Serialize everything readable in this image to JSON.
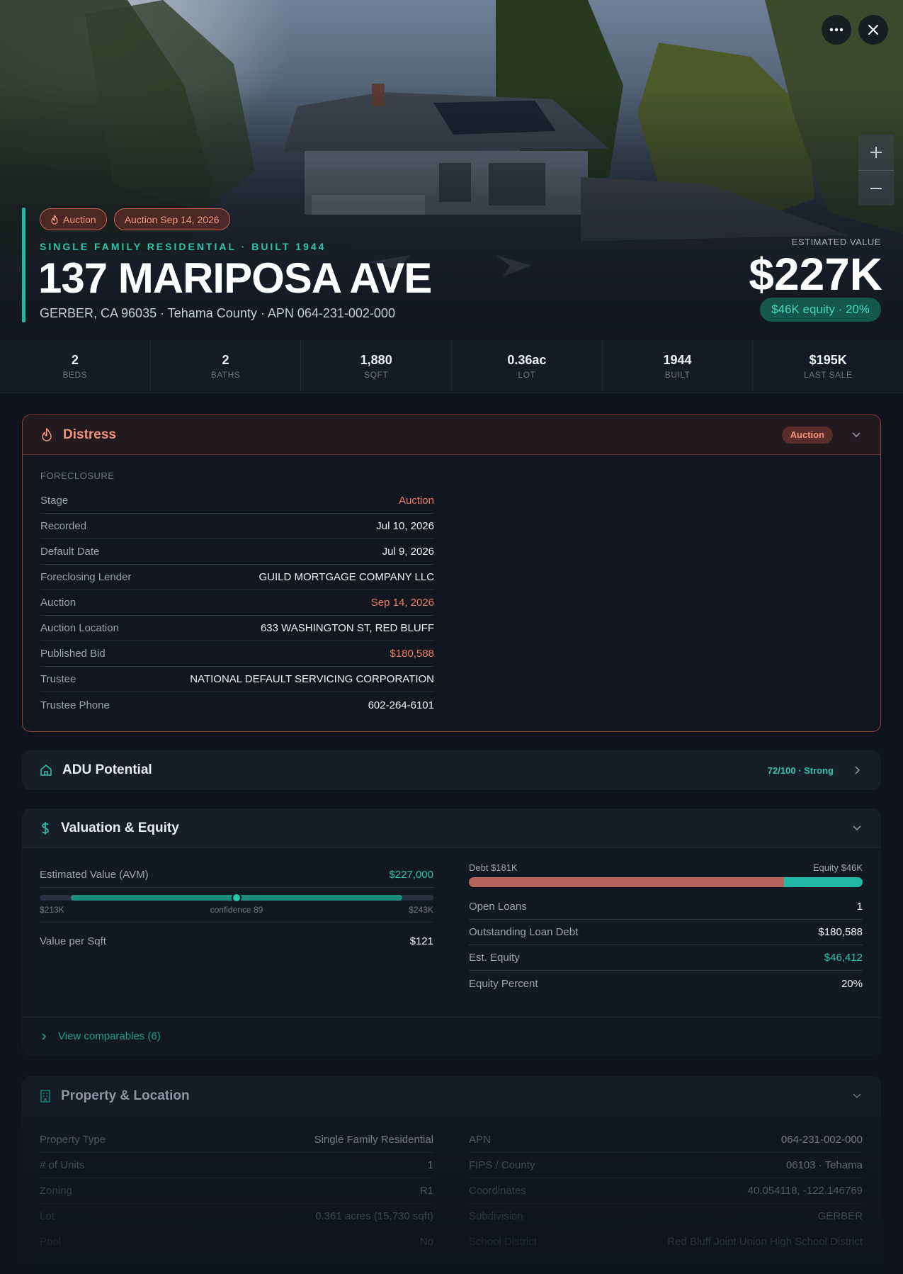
{
  "hero": {
    "badges": [
      "Auction",
      "Auction Sep 14, 2026"
    ],
    "subtitle": "SINGLE FAMILY RESIDENTIAL · BUILT 1944",
    "title": "137 MARIPOSA AVE",
    "location": "GERBER, CA 96035 · Tehama County · APN 064-231-002-000",
    "estimated_label": "ESTIMATED VALUE",
    "estimated_value": "$227K",
    "equity_pill": "$46K equity · 20%"
  },
  "stats": [
    {
      "value": "2",
      "label": "BEDS"
    },
    {
      "value": "2",
      "label": "BATHS"
    },
    {
      "value": "1,880",
      "label": "SQFT"
    },
    {
      "value": "0.36ac",
      "label": "LOT"
    },
    {
      "value": "1944",
      "label": "BUILT"
    },
    {
      "value": "$195K",
      "label": "LAST SALE"
    }
  ],
  "distress": {
    "title": "Distress",
    "badge": "Auction",
    "section": "FORECLOSURE",
    "rows": [
      {
        "k": "Stage",
        "v": "Auction"
      },
      {
        "k": "Recorded",
        "v": "Jul 10, 2026"
      },
      {
        "k": "Default Date",
        "v": "Jul 9, 2026"
      },
      {
        "k": "Foreclosing Lender",
        "v": "GUILD MORTGAGE COMPANY LLC"
      },
      {
        "k": "Auction",
        "v": "Sep 14, 2026"
      },
      {
        "k": "Auction Location",
        "v": "633 WASHINGTON ST, RED BLUFF"
      },
      {
        "k": "Published Bid",
        "v": "$180,588"
      },
      {
        "k": "Trustee",
        "v": "NATIONAL DEFAULT SERVICING CORPORATION"
      },
      {
        "k": "Trustee Phone",
        "v": "602-264-6101"
      }
    ]
  },
  "adu": {
    "title": "ADU Potential",
    "score": "72/100 · Strong"
  },
  "valuation": {
    "title": "Valuation & Equity",
    "avm_label": "Estimated Value (AVM)",
    "avm_value": "$227,000",
    "range_low": "$213K",
    "range_mid": "confidence 89",
    "range_high": "$243K",
    "range_fill_start": 0.08,
    "range_fill_end": 0.92,
    "range_marker": 0.5,
    "value_per_sqft_label": "Value per Sqft",
    "value_per_sqft": "$121",
    "debt_label": "Debt $181K",
    "equity_label": "Equity $46K",
    "debt_fraction": 0.8,
    "rows": [
      {
        "k": "Open Loans",
        "v": "1"
      },
      {
        "k": "Outstanding Loan Debt",
        "v": "$180,588"
      },
      {
        "k": "Est. Equity",
        "v": "$46,412"
      },
      {
        "k": "Equity Percent",
        "v": "20%"
      }
    ],
    "comparables": "View comparables (6)"
  },
  "property": {
    "title": "Property & Location",
    "left": [
      {
        "k": "Property Type",
        "v": "Single Family Residential"
      },
      {
        "k": "# of Units",
        "v": "1"
      },
      {
        "k": "Zoning",
        "v": "R1"
      },
      {
        "k": "Lot",
        "v": "0.361 acres (15,730 sqft)"
      },
      {
        "k": "Pool",
        "v": "No"
      }
    ],
    "right": [
      {
        "k": "APN",
        "v": "064-231-002-000"
      },
      {
        "k": "FIPS / County",
        "v": "06103 · Tehama"
      },
      {
        "k": "Coordinates",
        "v": "40.054118, -122.146769"
      },
      {
        "k": "Subdivision",
        "v": "GERBER"
      },
      {
        "k": "School District",
        "v": "Red Bluff Joint Union High School District"
      }
    ]
  },
  "colors": {
    "accent_teal": "#2ec4ae",
    "distress_red": "#ee7c62",
    "background": "#0e131c"
  }
}
